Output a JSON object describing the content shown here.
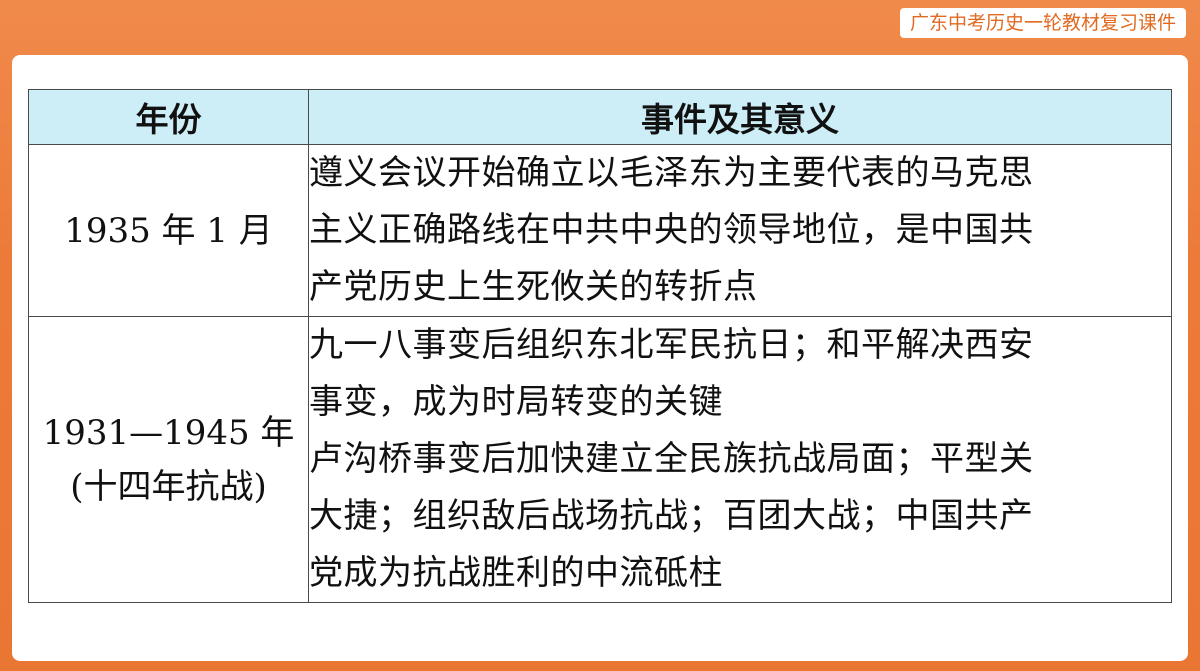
{
  "header": {
    "badge_text": "广东中考历史一轮教材复习课件"
  },
  "table": {
    "columns": [
      "年份",
      "事件及其意义"
    ],
    "rows": [
      {
        "year_lines": [
          "1935 年 1 月"
        ],
        "event_lines": [
          "遵义会议开始确立以毛泽东为主要代表的马克思",
          "主义正确路线在中共中央的领导地位，是中国共",
          "产党历史上生死攸关的转折点"
        ]
      },
      {
        "year_lines": [
          "1931—1945 年",
          "(十四年抗战)"
        ],
        "event_lines": [
          "九一八事变后组织东北军民抗日；和平解决西安",
          "事变，成为时局转变的关键",
          "卢沟桥事变后加快建立全民族抗战局面；平型关",
          "大捷；组织敌后战场抗战；百团大战；中国共产",
          "党成为抗战胜利的中流砥柱"
        ]
      }
    ]
  },
  "colors": {
    "frame": "#ee7f3f",
    "header_fill": "#cdeef7",
    "badge_text": "#e06a22"
  }
}
